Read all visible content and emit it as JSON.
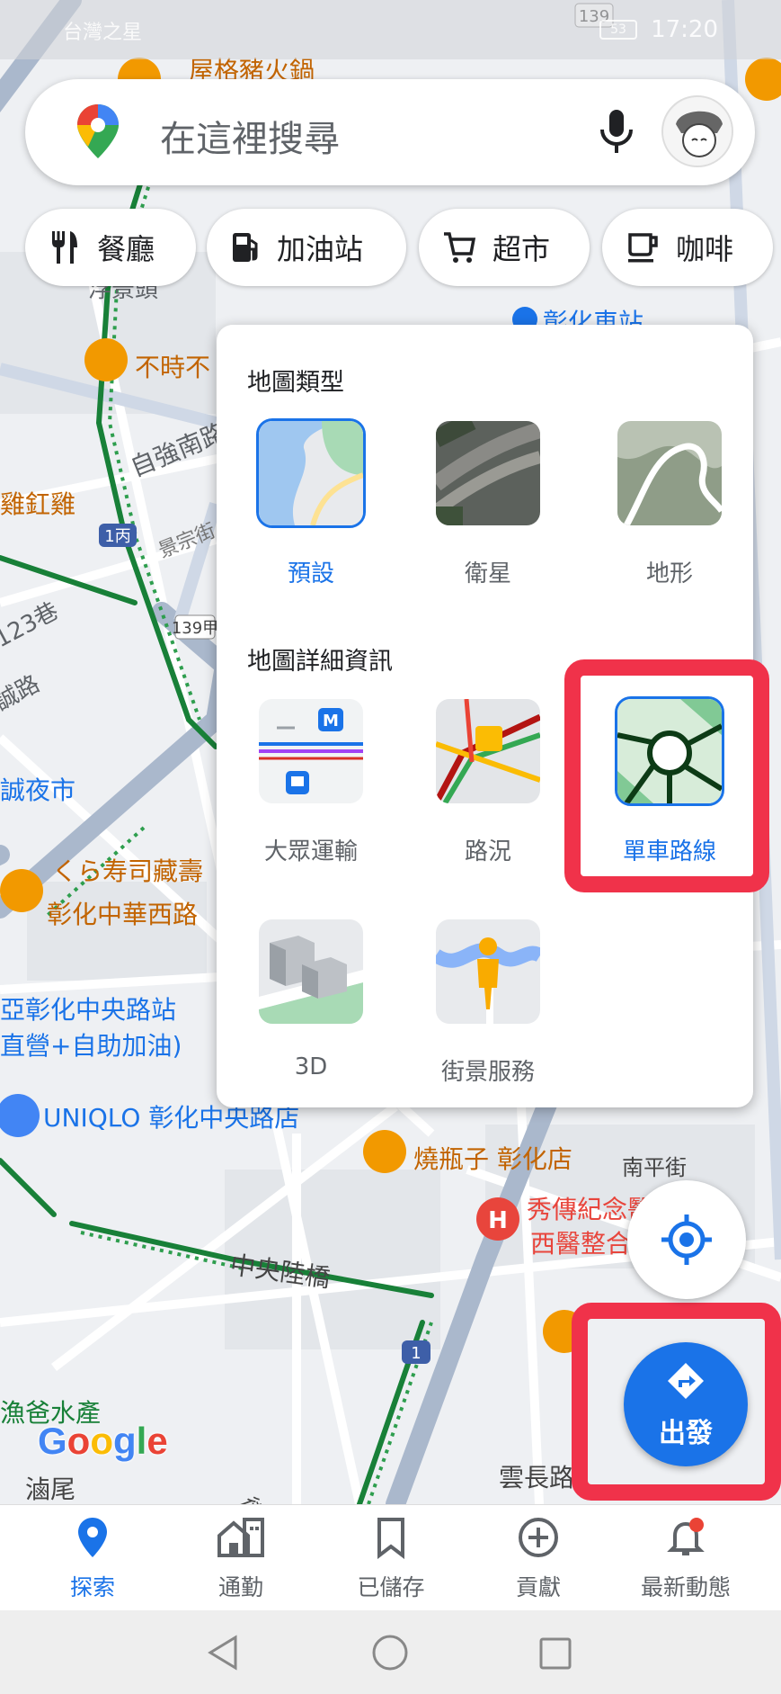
{
  "status_bar": {
    "carrier": "台灣之星",
    "time": "17:20",
    "battery": "53"
  },
  "search": {
    "placeholder": "在這裡搜尋"
  },
  "chips": [
    {
      "label": "餐廳",
      "icon": "fork-knife-icon"
    },
    {
      "label": "加油站",
      "icon": "gas-pump-icon"
    },
    {
      "label": "超市",
      "icon": "cart-icon"
    },
    {
      "label": "咖啡",
      "icon": "coffee-cup-icon"
    }
  ],
  "map_labels": {
    "road_139": "139",
    "pork": "屋格豬火鍋",
    "fuzhen": "浮景頭",
    "station": "彰化車站",
    "bushi": "不時不",
    "ziqiang": "自強南路",
    "jigang": "雞釭雞",
    "jingzong": "景宗街",
    "r1bing": "1丙",
    "xiang123": "123巷",
    "chengcheng": "誠路",
    "r139jia": "139甲",
    "chengnight": "誠夜市",
    "kura": "くら寿司藏壽",
    "zhonghuaxi": "彰化中華西路",
    "zhongyang_station": "亞彰化中央路站",
    "self_gas": "直營+自助加油)",
    "uniqlo": "UNIQLO 彰化中央路店",
    "shaoping": "燒瓶子 彰化店",
    "nanping": "南平街",
    "xiuchuan": "秀傳紀念醫院",
    "xiuchuan2": "西醫整合中心",
    "zhongyang_bridge": "中央陸橋",
    "r1": "1",
    "yuye": "漁爸水產",
    "google": "Google",
    "diwei": "滷尾",
    "yunchang": "雲長路",
    "r1_right": "1",
    "jie": "街"
  },
  "panel": {
    "map_type_title": "地圖類型",
    "map_types": [
      {
        "label": "預設",
        "selected": true
      },
      {
        "label": "衛星",
        "selected": false
      },
      {
        "label": "地形",
        "selected": false
      }
    ],
    "details_title": "地圖詳細資訊",
    "details": [
      {
        "label": "大眾運輸",
        "selected": false
      },
      {
        "label": "路況",
        "selected": false
      },
      {
        "label": "單車路線",
        "selected": true
      },
      {
        "label": "3D",
        "selected": false
      },
      {
        "label": "街景服務",
        "selected": false
      }
    ]
  },
  "go_button": {
    "label": "出發"
  },
  "bottom_nav": [
    {
      "label": "探索",
      "icon": "location-pin-icon",
      "active": true
    },
    {
      "label": "通勤",
      "icon": "commute-icon",
      "active": false
    },
    {
      "label": "已儲存",
      "icon": "bookmark-icon",
      "active": false
    },
    {
      "label": "貢獻",
      "icon": "add-circle-icon",
      "active": false
    },
    {
      "label": "最新動態",
      "icon": "bell-icon",
      "active": false
    }
  ],
  "colors": {
    "accent": "#1a73e8",
    "highlight": "#f0324a",
    "bike_path": "#188038",
    "poi_orange": "#f29900"
  }
}
